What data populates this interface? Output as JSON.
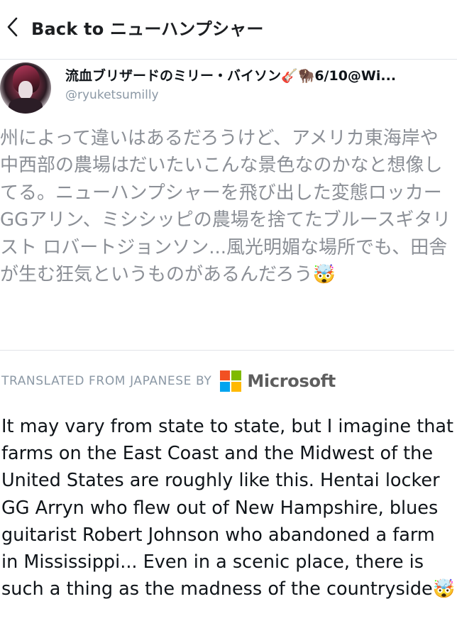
{
  "header": {
    "back_label": "Back to ニューハンプシャー"
  },
  "author": {
    "display_name": "流血ブリザードのミリー・バイソン🎸🦬6/10@Wi...",
    "handle": "@ryuketsumilly"
  },
  "tweet": {
    "original_text": "州によって違いはあるだろうけど、アメリカ東海岸や中西部の農場はだいたいこんな景色なのかなと想像してる。ニューハンプシャーを飛び出した変態ロッカーGGアリン、ミシシッピの農場を捨てたブルースギタリスト ロバートジョンソン...風光明媚な場所でも、田舎が生む狂気というものがあるんだろう🤯",
    "translated_text": "It may vary from state to state, but I imagine that farms on the East Coast and the Midwest of the United States are roughly like this. Hentai locker GG Arryn who flew out of New Hampshire, blues guitarist Robert Johnson who abandoned a farm in Mississippi... Even in a scenic place, there is such a thing as the madness of the countryside🤯"
  },
  "translation_credit": {
    "label": "TRANSLATED FROM JAPANESE BY",
    "provider": "Microsoft",
    "logo_colors": [
      "#f25022",
      "#7fba00",
      "#00a4ef",
      "#ffb900"
    ]
  },
  "icons": {
    "back": "chevron-left-icon",
    "provider_logo": "microsoft-logo-icon"
  }
}
